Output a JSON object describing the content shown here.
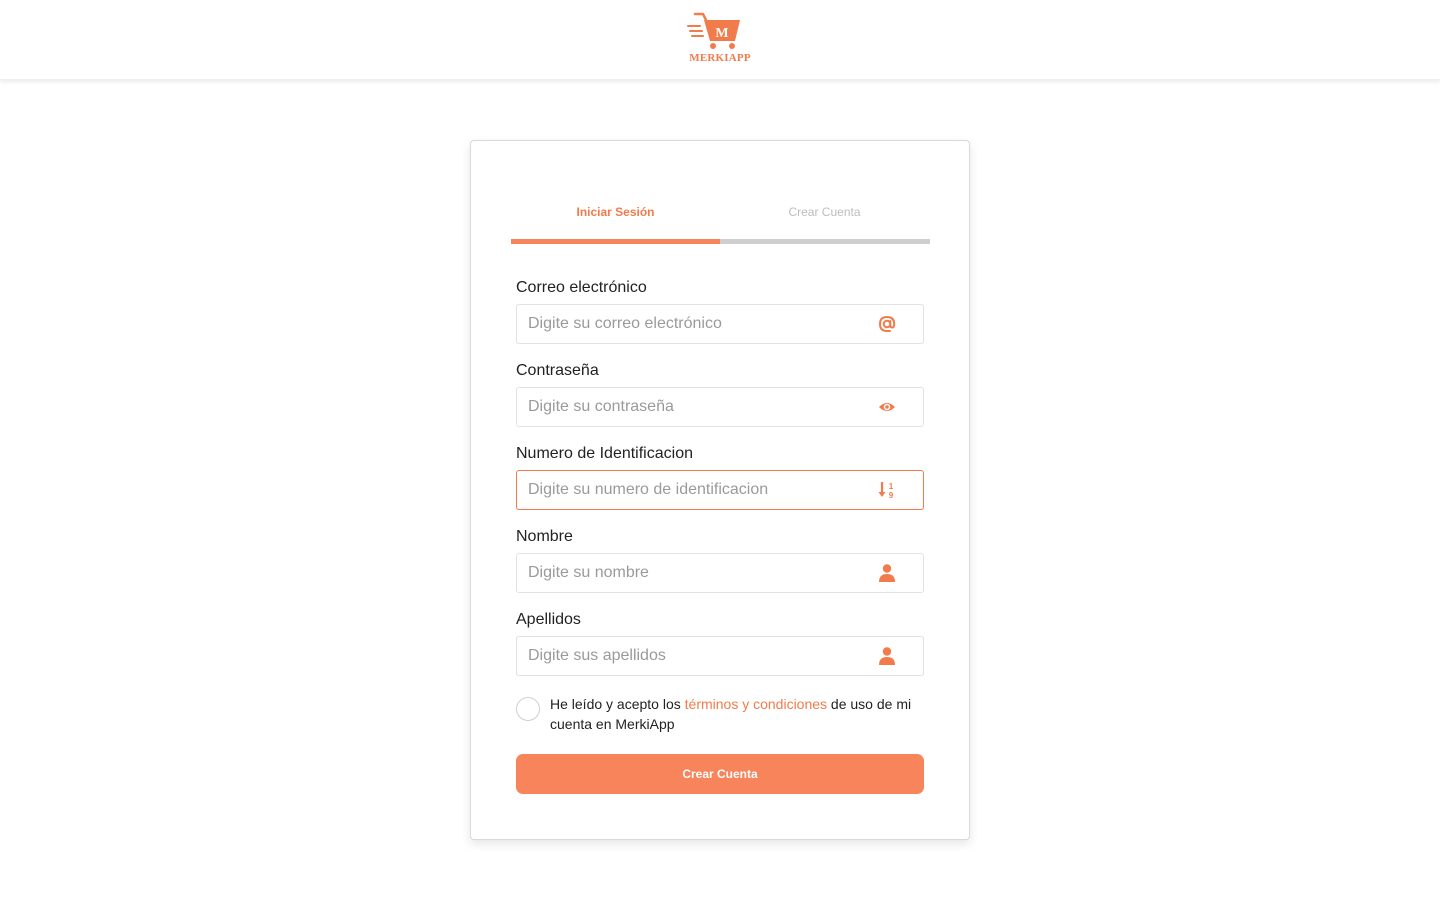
{
  "header": {
    "logo_letter": "M",
    "logo_text": "MERKIAPP"
  },
  "tabs": {
    "login_label": "Iniciar Sesión",
    "register_label": "Crear Cuenta",
    "active": "login"
  },
  "form": {
    "fields": [
      {
        "label": "Correo electrónico",
        "placeholder": "Digite su correo electrónico",
        "value": "",
        "icon": "at-icon"
      },
      {
        "label": "Contraseña",
        "placeholder": "Digite su contraseña",
        "value": "",
        "icon": "eye-icon"
      },
      {
        "label": "Numero de Identificacion",
        "placeholder": "Digite su numero de identificacion",
        "value": "",
        "icon": "sort-numeric-icon"
      },
      {
        "label": "Nombre",
        "placeholder": "Digite su nombre",
        "value": "",
        "icon": "user-icon"
      },
      {
        "label": "Apellidos",
        "placeholder": "Digite sus apellidos",
        "value": "",
        "icon": "user-icon"
      }
    ],
    "terms": {
      "prefix": "He leído y acepto los ",
      "link": "términos y condiciones",
      "suffix": " de uso de mi cuenta en MerkiApp",
      "checked": false
    },
    "submit_label": "Crear Cuenta"
  },
  "colors": {
    "accent": "#f27b4b",
    "button": "#f7845a",
    "inactive_tab": "#cfcfcf"
  }
}
